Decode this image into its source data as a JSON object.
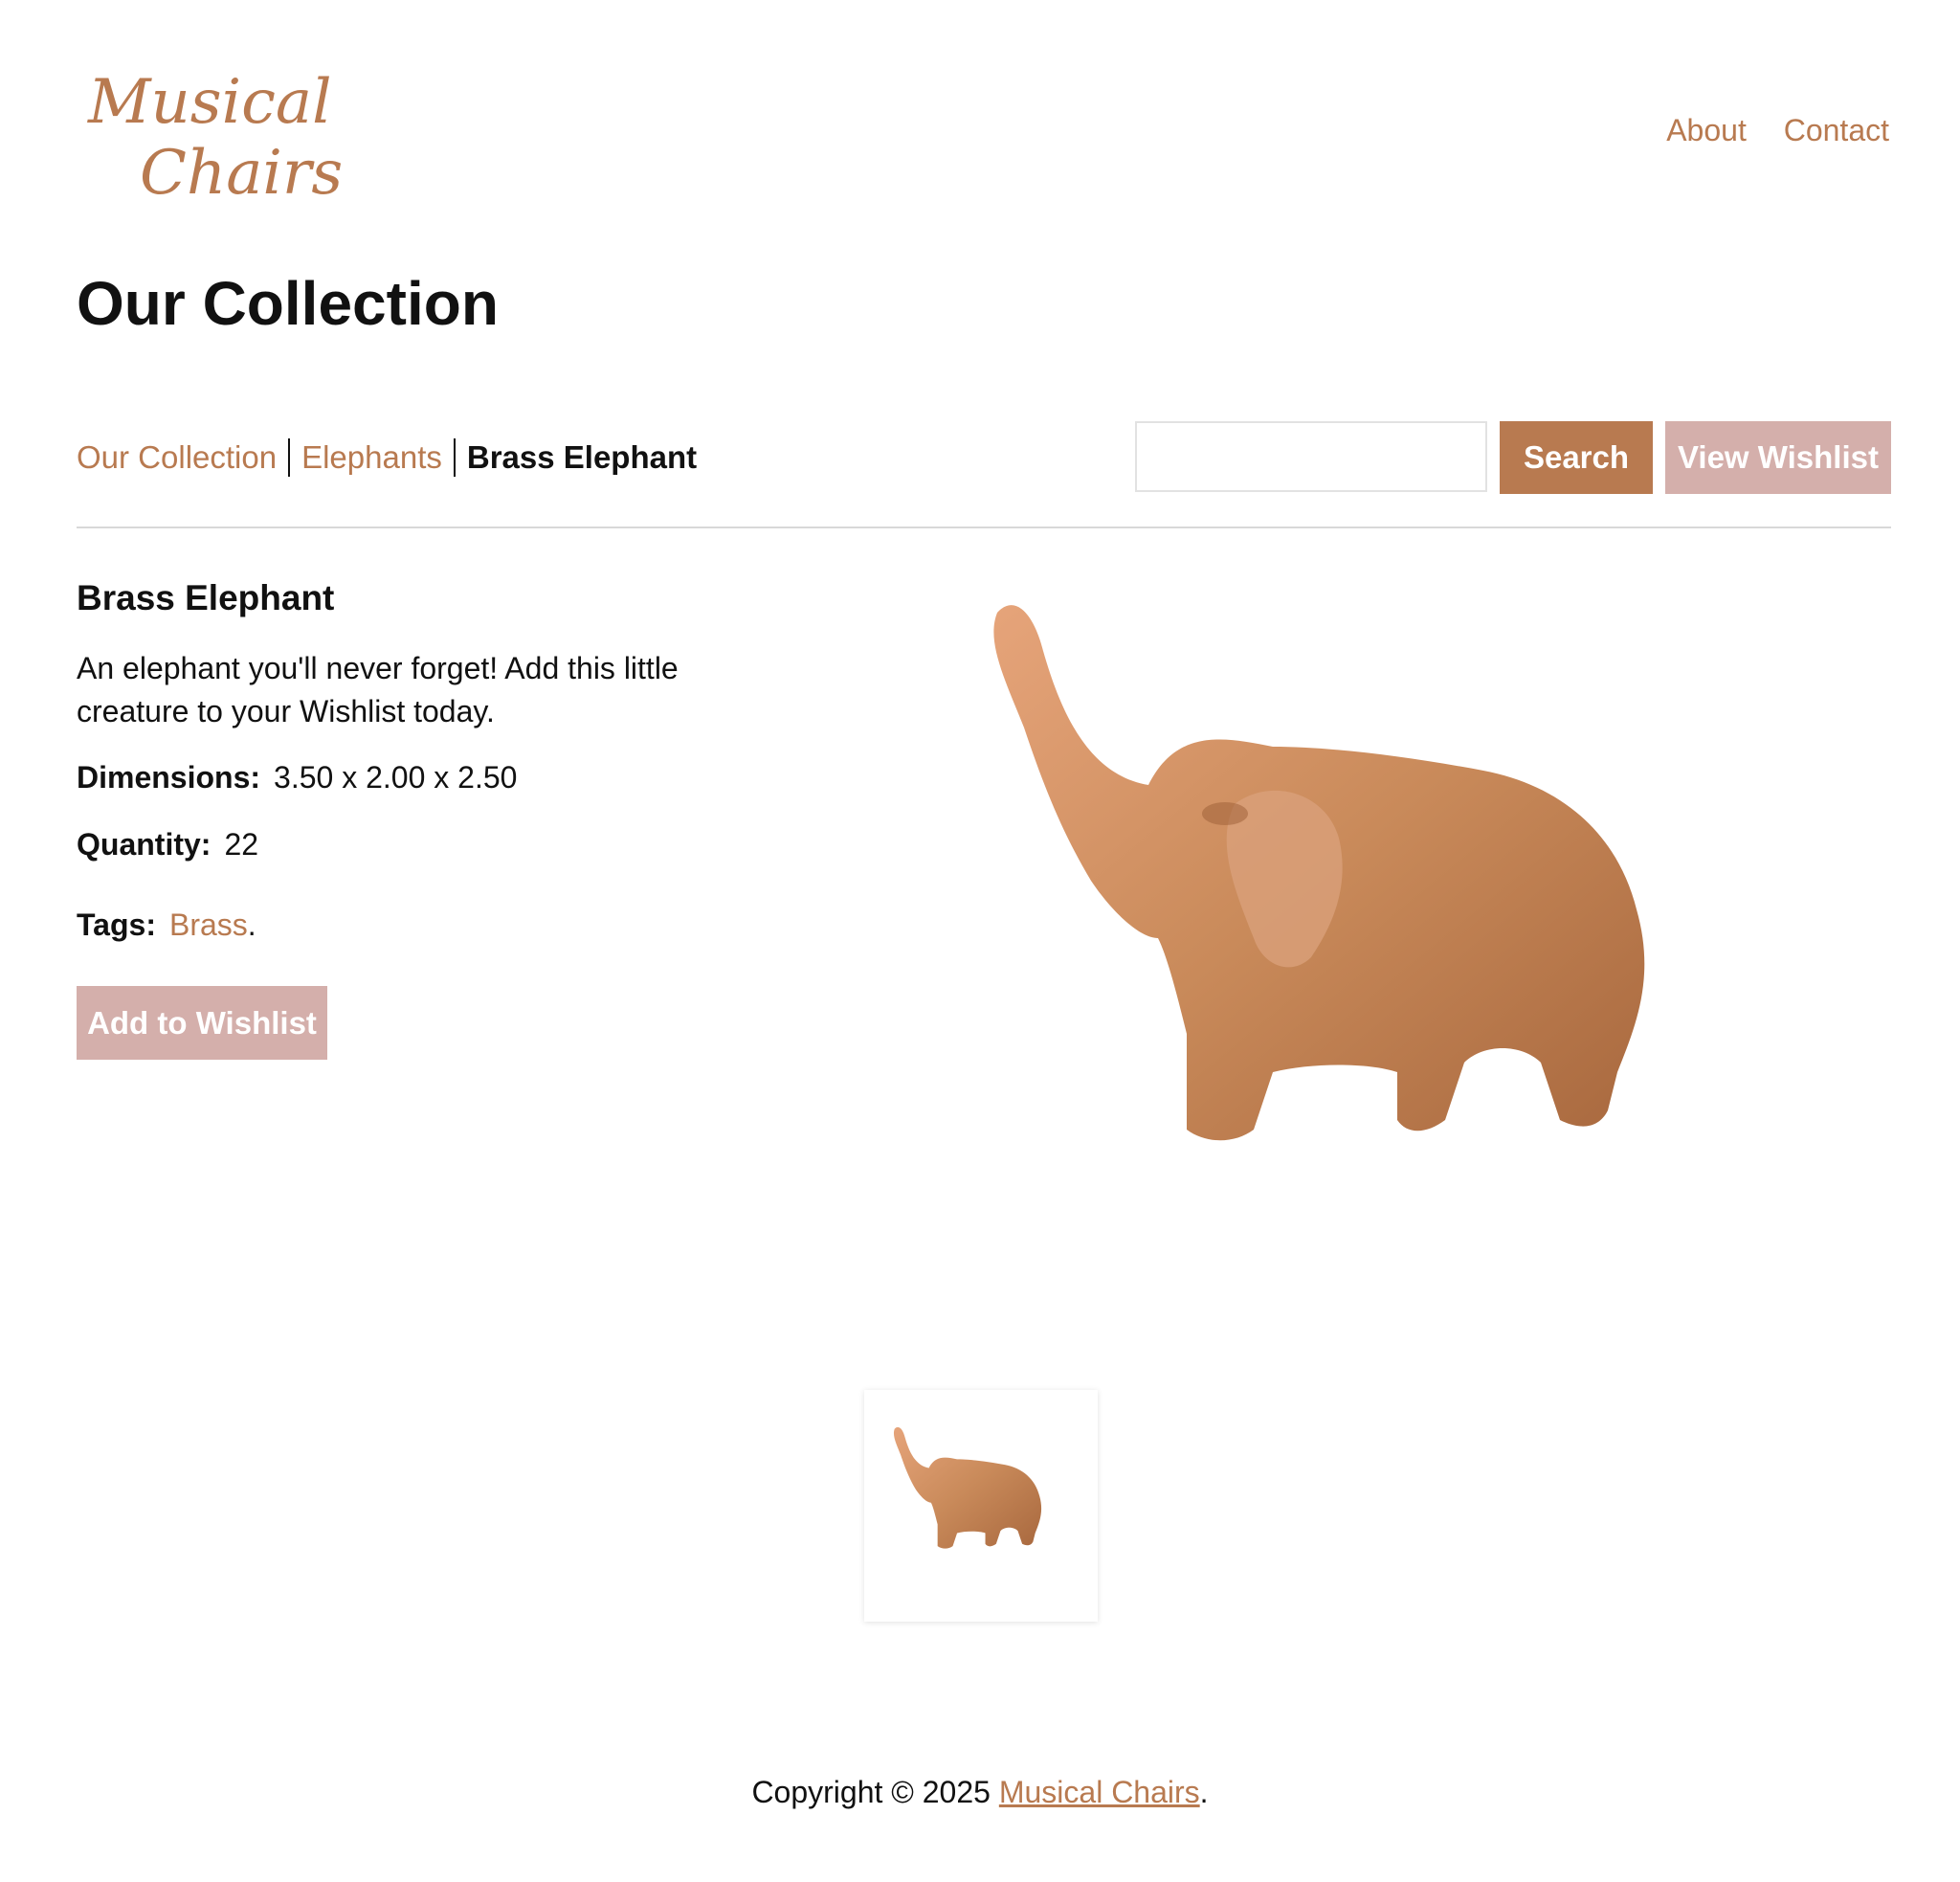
{
  "logo": {
    "line1": "Musical",
    "line2": "Chairs"
  },
  "nav": {
    "items": [
      {
        "label": "About"
      },
      {
        "label": "Contact"
      }
    ]
  },
  "page": {
    "title": "Our Collection"
  },
  "breadcrumb": {
    "items": [
      {
        "label": "Our Collection"
      },
      {
        "label": "Elephants"
      }
    ],
    "current": "Brass Elephant"
  },
  "search": {
    "value": "",
    "button_label": "Search"
  },
  "wishlist": {
    "view_label": "View Wishlist",
    "add_label": "Add to Wishlist"
  },
  "product": {
    "name": "Brass Elephant",
    "description": "An elephant you'll never forget! Add this little creature to your Wishlist today.",
    "dimensions_label": "Dimensions:",
    "dimensions": "3.50 x 2.00 x 2.50",
    "quantity_label": "Quantity:",
    "quantity": "22",
    "tags_label": "Tags:",
    "tags": [
      "Brass"
    ]
  },
  "footer": {
    "prefix": "Copyright © 2025 ",
    "link": "Musical Chairs",
    "suffix": "."
  },
  "colors": {
    "accent": "#b87a50",
    "wishlist": "#d4afab",
    "brass": "#c98a5a"
  }
}
